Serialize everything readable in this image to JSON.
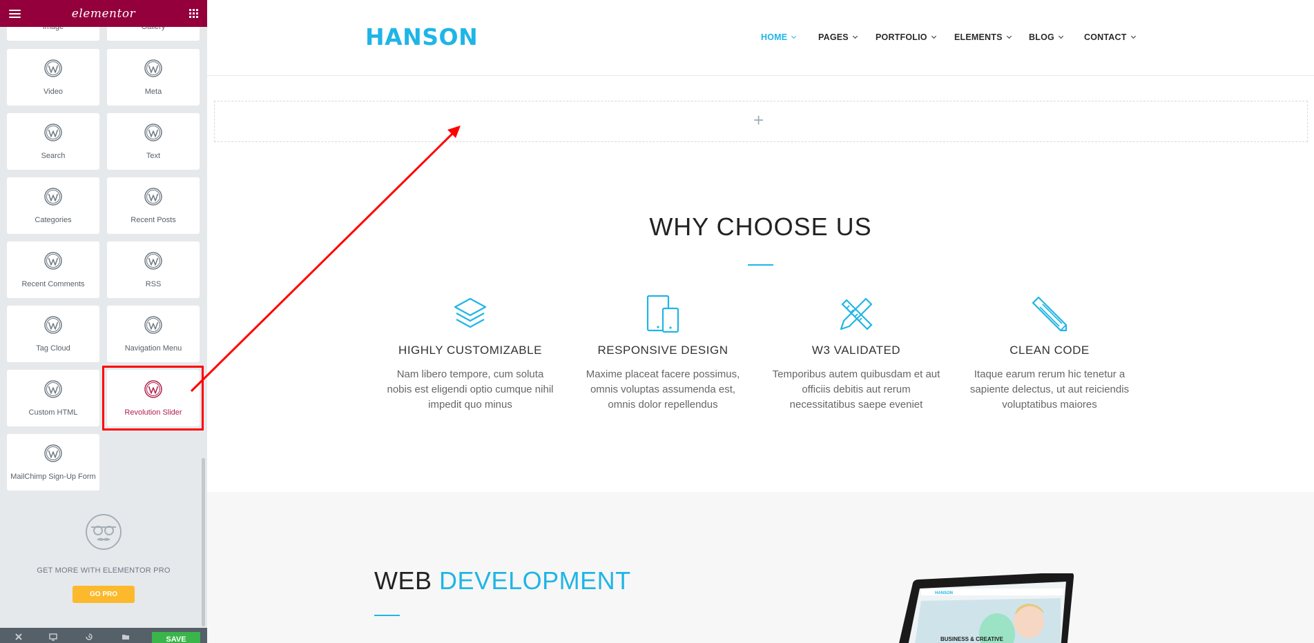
{
  "panel": {
    "logo": "elementor",
    "partial_widgets": [
      {
        "label": "Image"
      },
      {
        "label": "Gallery"
      }
    ],
    "widgets": [
      {
        "label": "Video"
      },
      {
        "label": "Meta"
      },
      {
        "label": "Search"
      },
      {
        "label": "Text"
      },
      {
        "label": "Categories"
      },
      {
        "label": "Recent Posts"
      },
      {
        "label": "Recent Comments"
      },
      {
        "label": "RSS"
      },
      {
        "label": "Tag Cloud"
      },
      {
        "label": "Navigation Menu"
      },
      {
        "label": "Custom HTML"
      },
      {
        "label": "Revolution Slider"
      },
      {
        "label": "MailChimp Sign-Up Form"
      }
    ],
    "promo_text": "GET MORE WITH ELEMENTOR PRO",
    "go_pro_label": "GO PRO",
    "save_label": "SAVE",
    "colors": {
      "header": "#93003c",
      "accent": "#fcb92c",
      "save": "#39b54a",
      "highlight": "#ff0000"
    }
  },
  "site": {
    "brand": "HANSON",
    "nav": [
      {
        "label": "HOME",
        "active": true
      },
      {
        "label": "PAGES",
        "active": false
      },
      {
        "label": "PORTFOLIO",
        "active": false
      },
      {
        "label": "ELEMENTS",
        "active": false
      },
      {
        "label": "BLOG",
        "active": false
      },
      {
        "label": "CONTACT",
        "active": false
      }
    ],
    "add_section_symbol": "+",
    "why_title": "WHY CHOOSE US",
    "features": [
      {
        "icon": "layers-icon",
        "title": "HIGHLY CUSTOMIZABLE",
        "desc": "Nam libero tempore, cum soluta nobis est eligendi optio cumque nihil impedit quo minus"
      },
      {
        "icon": "devices-icon",
        "title": "RESPONSIVE DESIGN",
        "desc": "Maxime placeat facere possimus, omnis voluptas assumenda est, omnis dolor repellendus"
      },
      {
        "icon": "pencil-ruler-icon",
        "title": "W3 VALIDATED",
        "desc": "Temporibus autem quibusdam et aut officiis debitis aut rerum necessitatibus saepe eveniet"
      },
      {
        "icon": "pencil-icon",
        "title": "CLEAN CODE",
        "desc": "Itaque earum rerum hic tenetur a sapiente delectus, ut aut reiciendis voluptatibus maiores"
      }
    ],
    "web_title_plain": "WEB",
    "web_title_accent": "DEVELOPMENT",
    "laptop_screen_text": [
      "HANSON",
      "BUSINESS & CREATIVE"
    ],
    "colors": {
      "brand": "#1fb5e6",
      "grey_section": "#f7f7f7"
    }
  }
}
